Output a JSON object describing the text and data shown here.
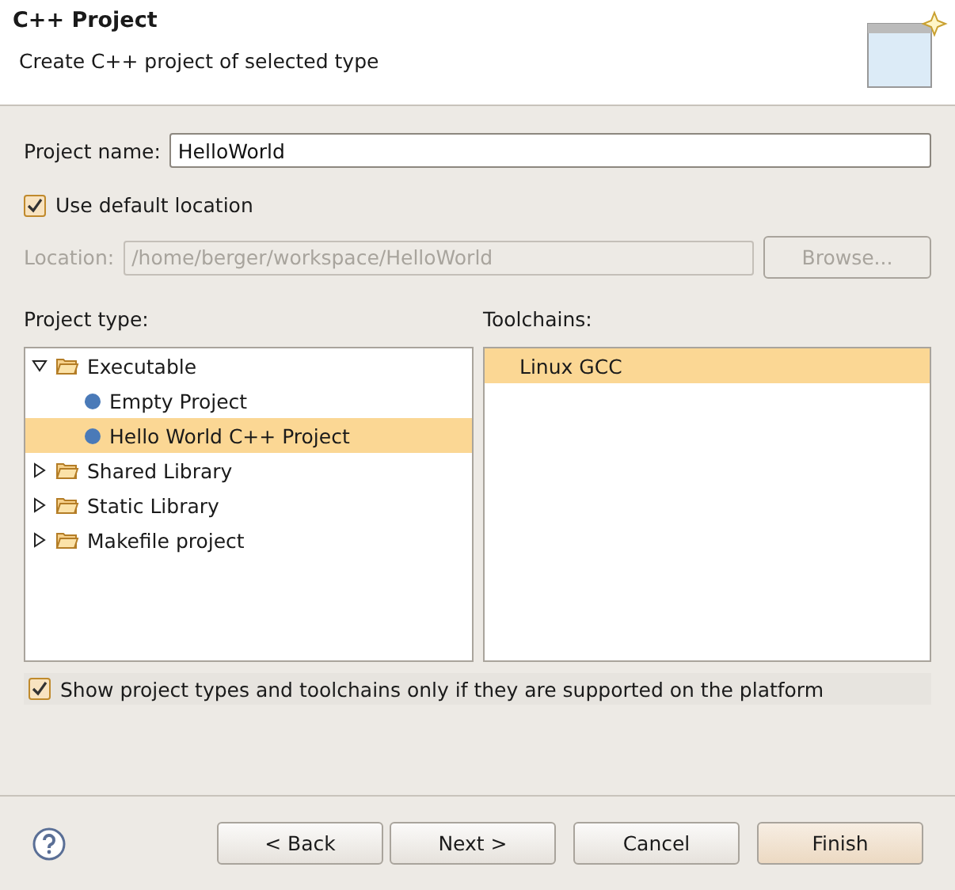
{
  "header": {
    "title": "C++ Project",
    "subtitle": "Create C++ project of selected type"
  },
  "project_name": {
    "label": "Project name:",
    "value": "HelloWorld"
  },
  "use_default_location": {
    "label": "Use default location",
    "checked": true
  },
  "location": {
    "label": "Location:",
    "value": "/home/berger/workspace/HelloWorld",
    "disabled": true,
    "browse": "Browse..."
  },
  "project_type": {
    "label": "Project type:",
    "items": [
      {
        "kind": "folder",
        "label": "Executable",
        "expanded": true,
        "selected": false,
        "children": [
          {
            "kind": "leaf",
            "label": "Empty Project",
            "selected": false
          },
          {
            "kind": "leaf",
            "label": "Hello World C++ Project",
            "selected": true
          }
        ]
      },
      {
        "kind": "folder",
        "label": "Shared Library",
        "expanded": false,
        "selected": false
      },
      {
        "kind": "folder",
        "label": "Static Library",
        "expanded": false,
        "selected": false
      },
      {
        "kind": "folder",
        "label": "Makefile project",
        "expanded": false,
        "selected": false
      }
    ]
  },
  "toolchains": {
    "label": "Toolchains:",
    "items": [
      {
        "label": "Linux GCC",
        "selected": true
      }
    ]
  },
  "show_supported": {
    "label": "Show project types and toolchains only if they are supported on the platform",
    "checked": true
  },
  "buttons": [
    {
      "label": "< Back",
      "default": false
    },
    {
      "label": "Next >",
      "default": false
    },
    {
      "label": "Cancel",
      "default": false
    },
    {
      "label": "Finish",
      "default": true
    }
  ]
}
